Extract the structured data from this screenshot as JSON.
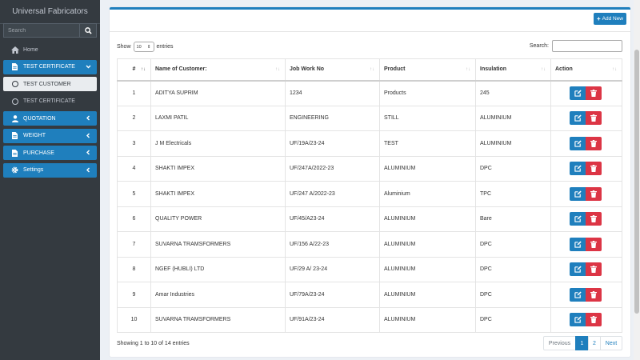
{
  "sidebar": {
    "brand": "Universal Fabricators",
    "search_placeholder": "Search",
    "items": [
      {
        "label": "Home"
      },
      {
        "label": "TEST CERTIFICATE"
      },
      {
        "label": "TEST CUSTOMER"
      },
      {
        "label": "TEST CERTIFICATE"
      },
      {
        "label": "QUOTATION"
      },
      {
        "label": "WEIGHT"
      },
      {
        "label": "PURCHASE"
      },
      {
        "label": "Settings"
      }
    ]
  },
  "header": {
    "add_label": "Add New"
  },
  "controls": {
    "show_label": "Show",
    "entries_value": "10",
    "entries_label": "entries",
    "search_label": "Search:"
  },
  "table": {
    "columns": [
      "#",
      "Name of Customer:",
      "Job Work No",
      "Product",
      "Insulation",
      "Action"
    ],
    "rows": [
      {
        "n": "1",
        "name": "ADITYA SUPRIM",
        "job": "1234",
        "product": "Products",
        "insulation": "245"
      },
      {
        "n": "2",
        "name": "LAXMI PATIL",
        "job": "ENGINEERING",
        "product": "STILL",
        "insulation": "ALUMINIUM"
      },
      {
        "n": "3",
        "name": "J M Electricals",
        "job": "UF/19A/23-24",
        "product": "TEST",
        "insulation": "ALUMINIUM"
      },
      {
        "n": "4",
        "name": "SHAKTI IMPEX",
        "job": "UF/247A/2022-23",
        "product": "ALUMINIUM",
        "insulation": "DPC"
      },
      {
        "n": "5",
        "name": "SHAKTI IMPEX",
        "job": "UF/247 A/2022-23",
        "product": "Aluminium",
        "insulation": "TPC"
      },
      {
        "n": "6",
        "name": "QUALITY POWER",
        "job": "UF/45/A23-24",
        "product": "ALUMINIUM",
        "insulation": "Bare"
      },
      {
        "n": "7",
        "name": "SUVARNA TRAMSFORMERS",
        "job": "UF/156 A/22-23",
        "product": "ALUMINIUM",
        "insulation": "DPC"
      },
      {
        "n": "8",
        "name": "NGEF (HUBLI) LTD",
        "job": "UF/29 A/ 23-24",
        "product": "ALUMINIUM",
        "insulation": "DPC"
      },
      {
        "n": "9",
        "name": "Amar Industries",
        "job": "UF/79A/23-24",
        "product": "ALUMINIUM",
        "insulation": "DPC"
      },
      {
        "n": "10",
        "name": "SUVARNA TRAMSFORMERS",
        "job": "UF/91A/23-24",
        "product": "ALUMINIUM",
        "insulation": "DPC"
      }
    ]
  },
  "footer": {
    "info": "Showing 1 to 10 of 14 entries",
    "prev": "Previous",
    "page1": "1",
    "page2": "2",
    "next": "Next"
  },
  "colors": {
    "primary": "#1f7fbd",
    "danger": "#dc3545",
    "sidebar": "#343a40"
  }
}
